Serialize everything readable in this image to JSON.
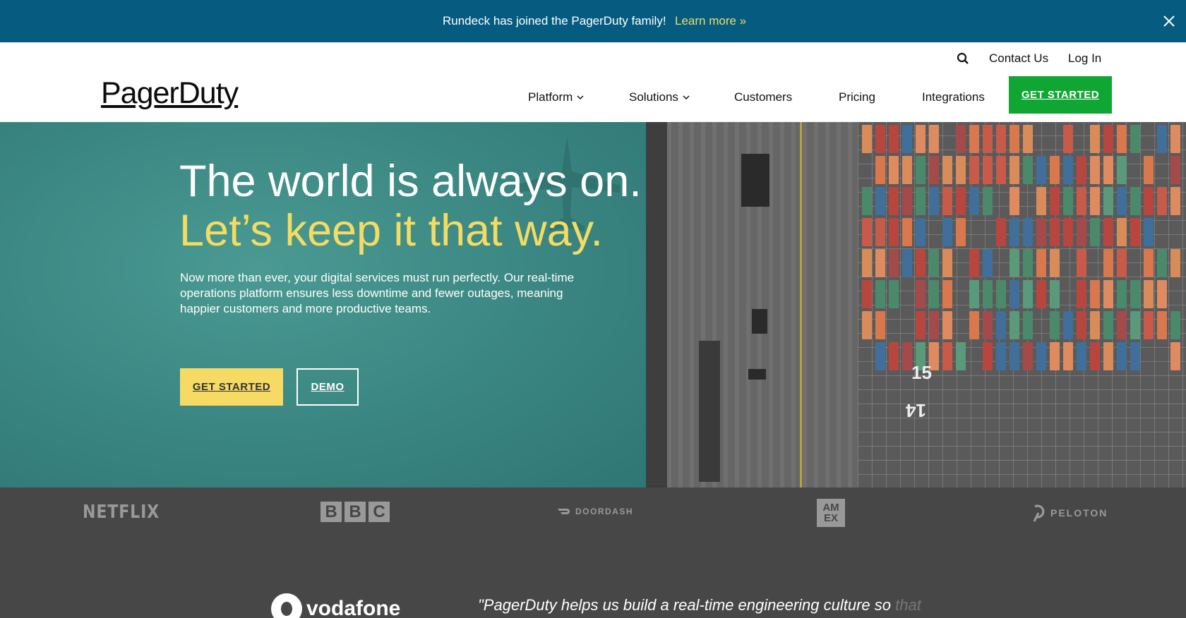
{
  "announcement": {
    "text": "Rundeck has joined the PagerDuty family!",
    "link": "Learn more »",
    "close_icon": "close-icon"
  },
  "header": {
    "logo": "PagerDuty",
    "utility": {
      "search_icon": "search-icon",
      "contact": "Contact Us",
      "login": "Log In"
    },
    "nav": [
      {
        "label": "Platform",
        "has_dropdown": true
      },
      {
        "label": "Solutions",
        "has_dropdown": true
      },
      {
        "label": "Customers",
        "has_dropdown": false
      },
      {
        "label": "Pricing",
        "has_dropdown": false
      },
      {
        "label": "Integrations",
        "has_dropdown": false
      }
    ],
    "cta": "GET STARTED"
  },
  "hero": {
    "headline": "The world is always on.",
    "subheadline": "Let’s keep it that way.",
    "body": "Now more than ever, your digital services must run perfectly. Our real-time operations platform ensures less downtime and fewer outages, meaning happier customers and more productive teams.",
    "primary_button": "GET STARTED",
    "secondary_button": "DEMO",
    "yard_numbers": [
      "15",
      "14"
    ]
  },
  "customers": {
    "logos": [
      "NETFLIX",
      "BBC",
      "DOORDASH",
      "AMEX",
      "PELOTON"
    ],
    "bbc_letters": [
      "B",
      "B",
      "C"
    ],
    "amex_lines": [
      "AM",
      "EX"
    ]
  },
  "testimonial": {
    "company": "vodafone",
    "quote": "\"PagerDuty helps us build a real-time engineering culture so",
    "quote_fade": " that"
  },
  "colors": {
    "announcement_bg": "#065c80",
    "accent_yellow": "#f4dc63",
    "cta_green": "#10a633",
    "logo_strip_bg": "#474747"
  }
}
